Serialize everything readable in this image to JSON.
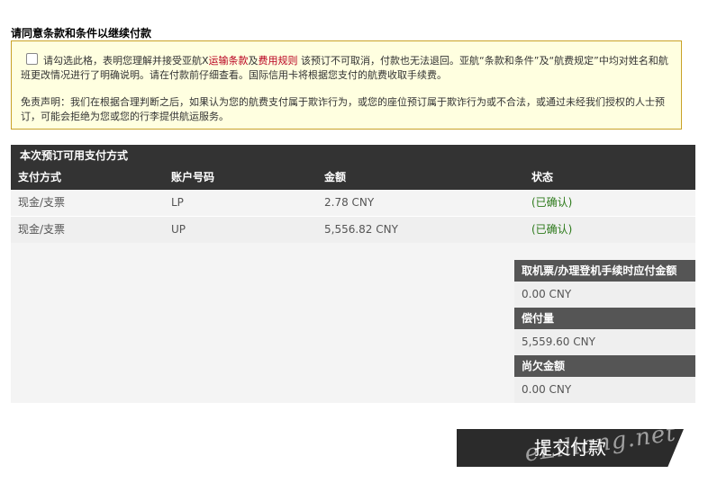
{
  "heading": "请同意条款和条件以继续付款",
  "notice": {
    "text_before_links": "请勾选此格，表明您理解并接受亚航X",
    "link_transport_terms": "运输条款",
    "connector": "及",
    "link_fee_rules": "费用规则",
    "text_after_links": "该预订不可取消，付款也无法退回。亚航“条款和条件”及“航费规定”中均对姓名和航班更改情况进行了明确说明。请在付款前仔细查看。国际信用卡将根据您支付的航费收取手续费。",
    "disclaimer": "免责声明：我们在根据合理判断之后，如果认为您的航费支付属于欺诈行为，或您的座位预订属于欺诈行为或不合法，或通过未经我们授权的人士预订，可能会拒绝为您或您的行李提供航运服务。"
  },
  "payment": {
    "title": "本次预订可用支付方式",
    "columns": [
      "支付方式",
      "账户号码",
      "金额",
      "状态"
    ],
    "rows": [
      {
        "method": "现金/支票",
        "account": "LP",
        "amount": "2.78 CNY",
        "status": "(已确认)"
      },
      {
        "method": "现金/支票",
        "account": "UP",
        "amount": "5,556.82 CNY",
        "status": "(已确认)"
      }
    ]
  },
  "summary": {
    "due_label": "取机票/办理登机手续时应付金额",
    "due_value": "0.00 CNY",
    "paid_label": "偿付量",
    "paid_value": "5,559.60 CNY",
    "outstanding_label": "尚欠金额",
    "outstanding_value": "0.00 CNY"
  },
  "submit_label": "提交付款",
  "watermark": "eLiliang.net"
}
